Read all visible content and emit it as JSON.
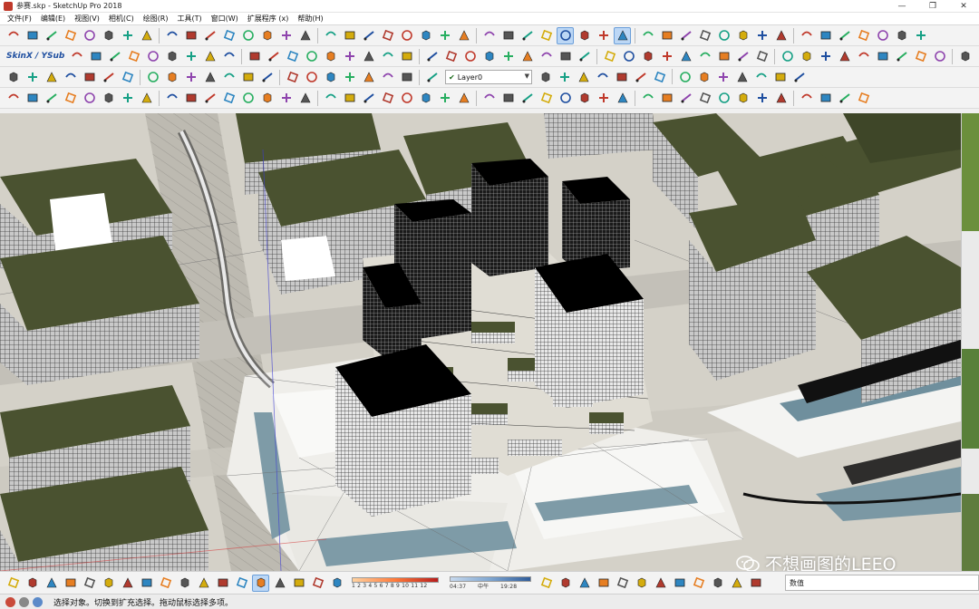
{
  "window": {
    "title": "参赛.skp - SketchUp Pro 2018",
    "controls": {
      "minimize": "—",
      "maximize": "❐",
      "close": "✕"
    }
  },
  "menu": [
    "文件(F)",
    "编辑(E)",
    "视图(V)",
    "相机(C)",
    "绘图(R)",
    "工具(T)",
    "窗口(W)",
    "扩展程序 (x)",
    "帮助(H)"
  ],
  "toolbar": {
    "skin_label": "SkinX / YSub",
    "layer_select": {
      "value": "Layer0"
    }
  },
  "status": {
    "message": "选择对象。切换到扩充选择。拖动鼠标选择多项。"
  },
  "measurements": {
    "label": "数值"
  },
  "shadow": {
    "month_scale": "1 2 3 4 5 6 7 8 9 10 11 12",
    "time_start": "04:37",
    "time_mid": "中午",
    "time_end": "19:28"
  },
  "watermark": {
    "text": "不想画图的LEEO"
  },
  "colors": {
    "roof": "#4a5230",
    "ground": "#d8d5cd",
    "tower": "#0d0d0d",
    "water": "#7d9aa6",
    "toolbar_bg": "#f3f3f3",
    "active_button": "#bcd7f5"
  }
}
